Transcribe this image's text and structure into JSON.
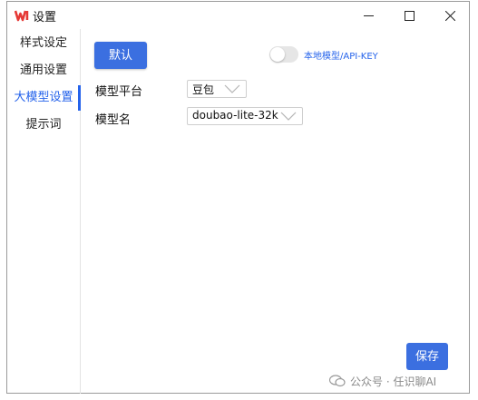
{
  "window": {
    "title": "设置",
    "accent": "#2563eb"
  },
  "sidebar": {
    "items": [
      {
        "label": "样式设定"
      },
      {
        "label": "通用设置"
      },
      {
        "label": "大模型设置",
        "active": true
      },
      {
        "label": "提示词"
      }
    ]
  },
  "main": {
    "default_button": "默认",
    "toggle_label": "本地模型/API-KEY",
    "toggle_on": false,
    "platform_label": "模型平台",
    "platform_value": "豆包",
    "model_label": "模型名",
    "model_value": "doubao-lite-32k",
    "save_button": "保存"
  },
  "watermark": {
    "text": "公众号 · 任识聊AI"
  }
}
